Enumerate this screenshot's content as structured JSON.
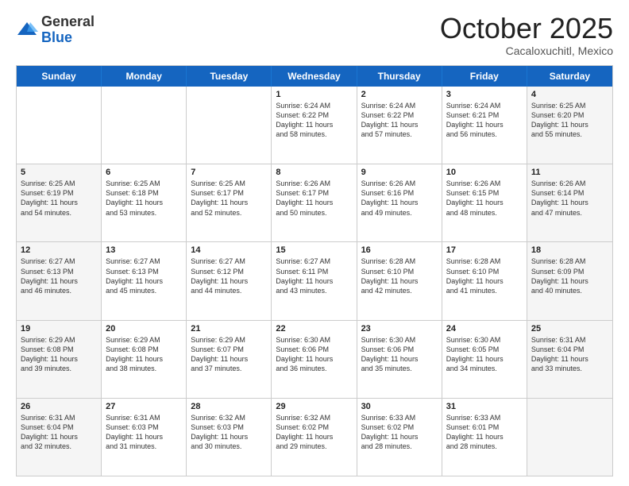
{
  "header": {
    "logo_general": "General",
    "logo_blue": "Blue",
    "month_title": "October 2025",
    "location": "Cacaloxuchitl, Mexico"
  },
  "weekdays": [
    "Sunday",
    "Monday",
    "Tuesday",
    "Wednesday",
    "Thursday",
    "Friday",
    "Saturday"
  ],
  "rows": [
    [
      {
        "day": "",
        "lines": [],
        "shaded": false
      },
      {
        "day": "",
        "lines": [],
        "shaded": false
      },
      {
        "day": "",
        "lines": [],
        "shaded": false
      },
      {
        "day": "1",
        "lines": [
          "Sunrise: 6:24 AM",
          "Sunset: 6:22 PM",
          "Daylight: 11 hours",
          "and 58 minutes."
        ],
        "shaded": false
      },
      {
        "day": "2",
        "lines": [
          "Sunrise: 6:24 AM",
          "Sunset: 6:22 PM",
          "Daylight: 11 hours",
          "and 57 minutes."
        ],
        "shaded": false
      },
      {
        "day": "3",
        "lines": [
          "Sunrise: 6:24 AM",
          "Sunset: 6:21 PM",
          "Daylight: 11 hours",
          "and 56 minutes."
        ],
        "shaded": false
      },
      {
        "day": "4",
        "lines": [
          "Sunrise: 6:25 AM",
          "Sunset: 6:20 PM",
          "Daylight: 11 hours",
          "and 55 minutes."
        ],
        "shaded": true
      }
    ],
    [
      {
        "day": "5",
        "lines": [
          "Sunrise: 6:25 AM",
          "Sunset: 6:19 PM",
          "Daylight: 11 hours",
          "and 54 minutes."
        ],
        "shaded": true
      },
      {
        "day": "6",
        "lines": [
          "Sunrise: 6:25 AM",
          "Sunset: 6:18 PM",
          "Daylight: 11 hours",
          "and 53 minutes."
        ],
        "shaded": false
      },
      {
        "day": "7",
        "lines": [
          "Sunrise: 6:25 AM",
          "Sunset: 6:17 PM",
          "Daylight: 11 hours",
          "and 52 minutes."
        ],
        "shaded": false
      },
      {
        "day": "8",
        "lines": [
          "Sunrise: 6:26 AM",
          "Sunset: 6:17 PM",
          "Daylight: 11 hours",
          "and 50 minutes."
        ],
        "shaded": false
      },
      {
        "day": "9",
        "lines": [
          "Sunrise: 6:26 AM",
          "Sunset: 6:16 PM",
          "Daylight: 11 hours",
          "and 49 minutes."
        ],
        "shaded": false
      },
      {
        "day": "10",
        "lines": [
          "Sunrise: 6:26 AM",
          "Sunset: 6:15 PM",
          "Daylight: 11 hours",
          "and 48 minutes."
        ],
        "shaded": false
      },
      {
        "day": "11",
        "lines": [
          "Sunrise: 6:26 AM",
          "Sunset: 6:14 PM",
          "Daylight: 11 hours",
          "and 47 minutes."
        ],
        "shaded": true
      }
    ],
    [
      {
        "day": "12",
        "lines": [
          "Sunrise: 6:27 AM",
          "Sunset: 6:13 PM",
          "Daylight: 11 hours",
          "and 46 minutes."
        ],
        "shaded": true
      },
      {
        "day": "13",
        "lines": [
          "Sunrise: 6:27 AM",
          "Sunset: 6:13 PM",
          "Daylight: 11 hours",
          "and 45 minutes."
        ],
        "shaded": false
      },
      {
        "day": "14",
        "lines": [
          "Sunrise: 6:27 AM",
          "Sunset: 6:12 PM",
          "Daylight: 11 hours",
          "and 44 minutes."
        ],
        "shaded": false
      },
      {
        "day": "15",
        "lines": [
          "Sunrise: 6:27 AM",
          "Sunset: 6:11 PM",
          "Daylight: 11 hours",
          "and 43 minutes."
        ],
        "shaded": false
      },
      {
        "day": "16",
        "lines": [
          "Sunrise: 6:28 AM",
          "Sunset: 6:10 PM",
          "Daylight: 11 hours",
          "and 42 minutes."
        ],
        "shaded": false
      },
      {
        "day": "17",
        "lines": [
          "Sunrise: 6:28 AM",
          "Sunset: 6:10 PM",
          "Daylight: 11 hours",
          "and 41 minutes."
        ],
        "shaded": false
      },
      {
        "day": "18",
        "lines": [
          "Sunrise: 6:28 AM",
          "Sunset: 6:09 PM",
          "Daylight: 11 hours",
          "and 40 minutes."
        ],
        "shaded": true
      }
    ],
    [
      {
        "day": "19",
        "lines": [
          "Sunrise: 6:29 AM",
          "Sunset: 6:08 PM",
          "Daylight: 11 hours",
          "and 39 minutes."
        ],
        "shaded": true
      },
      {
        "day": "20",
        "lines": [
          "Sunrise: 6:29 AM",
          "Sunset: 6:08 PM",
          "Daylight: 11 hours",
          "and 38 minutes."
        ],
        "shaded": false
      },
      {
        "day": "21",
        "lines": [
          "Sunrise: 6:29 AM",
          "Sunset: 6:07 PM",
          "Daylight: 11 hours",
          "and 37 minutes."
        ],
        "shaded": false
      },
      {
        "day": "22",
        "lines": [
          "Sunrise: 6:30 AM",
          "Sunset: 6:06 PM",
          "Daylight: 11 hours",
          "and 36 minutes."
        ],
        "shaded": false
      },
      {
        "day": "23",
        "lines": [
          "Sunrise: 6:30 AM",
          "Sunset: 6:06 PM",
          "Daylight: 11 hours",
          "and 35 minutes."
        ],
        "shaded": false
      },
      {
        "day": "24",
        "lines": [
          "Sunrise: 6:30 AM",
          "Sunset: 6:05 PM",
          "Daylight: 11 hours",
          "and 34 minutes."
        ],
        "shaded": false
      },
      {
        "day": "25",
        "lines": [
          "Sunrise: 6:31 AM",
          "Sunset: 6:04 PM",
          "Daylight: 11 hours",
          "and 33 minutes."
        ],
        "shaded": true
      }
    ],
    [
      {
        "day": "26",
        "lines": [
          "Sunrise: 6:31 AM",
          "Sunset: 6:04 PM",
          "Daylight: 11 hours",
          "and 32 minutes."
        ],
        "shaded": true
      },
      {
        "day": "27",
        "lines": [
          "Sunrise: 6:31 AM",
          "Sunset: 6:03 PM",
          "Daylight: 11 hours",
          "and 31 minutes."
        ],
        "shaded": false
      },
      {
        "day": "28",
        "lines": [
          "Sunrise: 6:32 AM",
          "Sunset: 6:03 PM",
          "Daylight: 11 hours",
          "and 30 minutes."
        ],
        "shaded": false
      },
      {
        "day": "29",
        "lines": [
          "Sunrise: 6:32 AM",
          "Sunset: 6:02 PM",
          "Daylight: 11 hours",
          "and 29 minutes."
        ],
        "shaded": false
      },
      {
        "day": "30",
        "lines": [
          "Sunrise: 6:33 AM",
          "Sunset: 6:02 PM",
          "Daylight: 11 hours",
          "and 28 minutes."
        ],
        "shaded": false
      },
      {
        "day": "31",
        "lines": [
          "Sunrise: 6:33 AM",
          "Sunset: 6:01 PM",
          "Daylight: 11 hours",
          "and 28 minutes."
        ],
        "shaded": false
      },
      {
        "day": "",
        "lines": [],
        "shaded": true
      }
    ]
  ]
}
